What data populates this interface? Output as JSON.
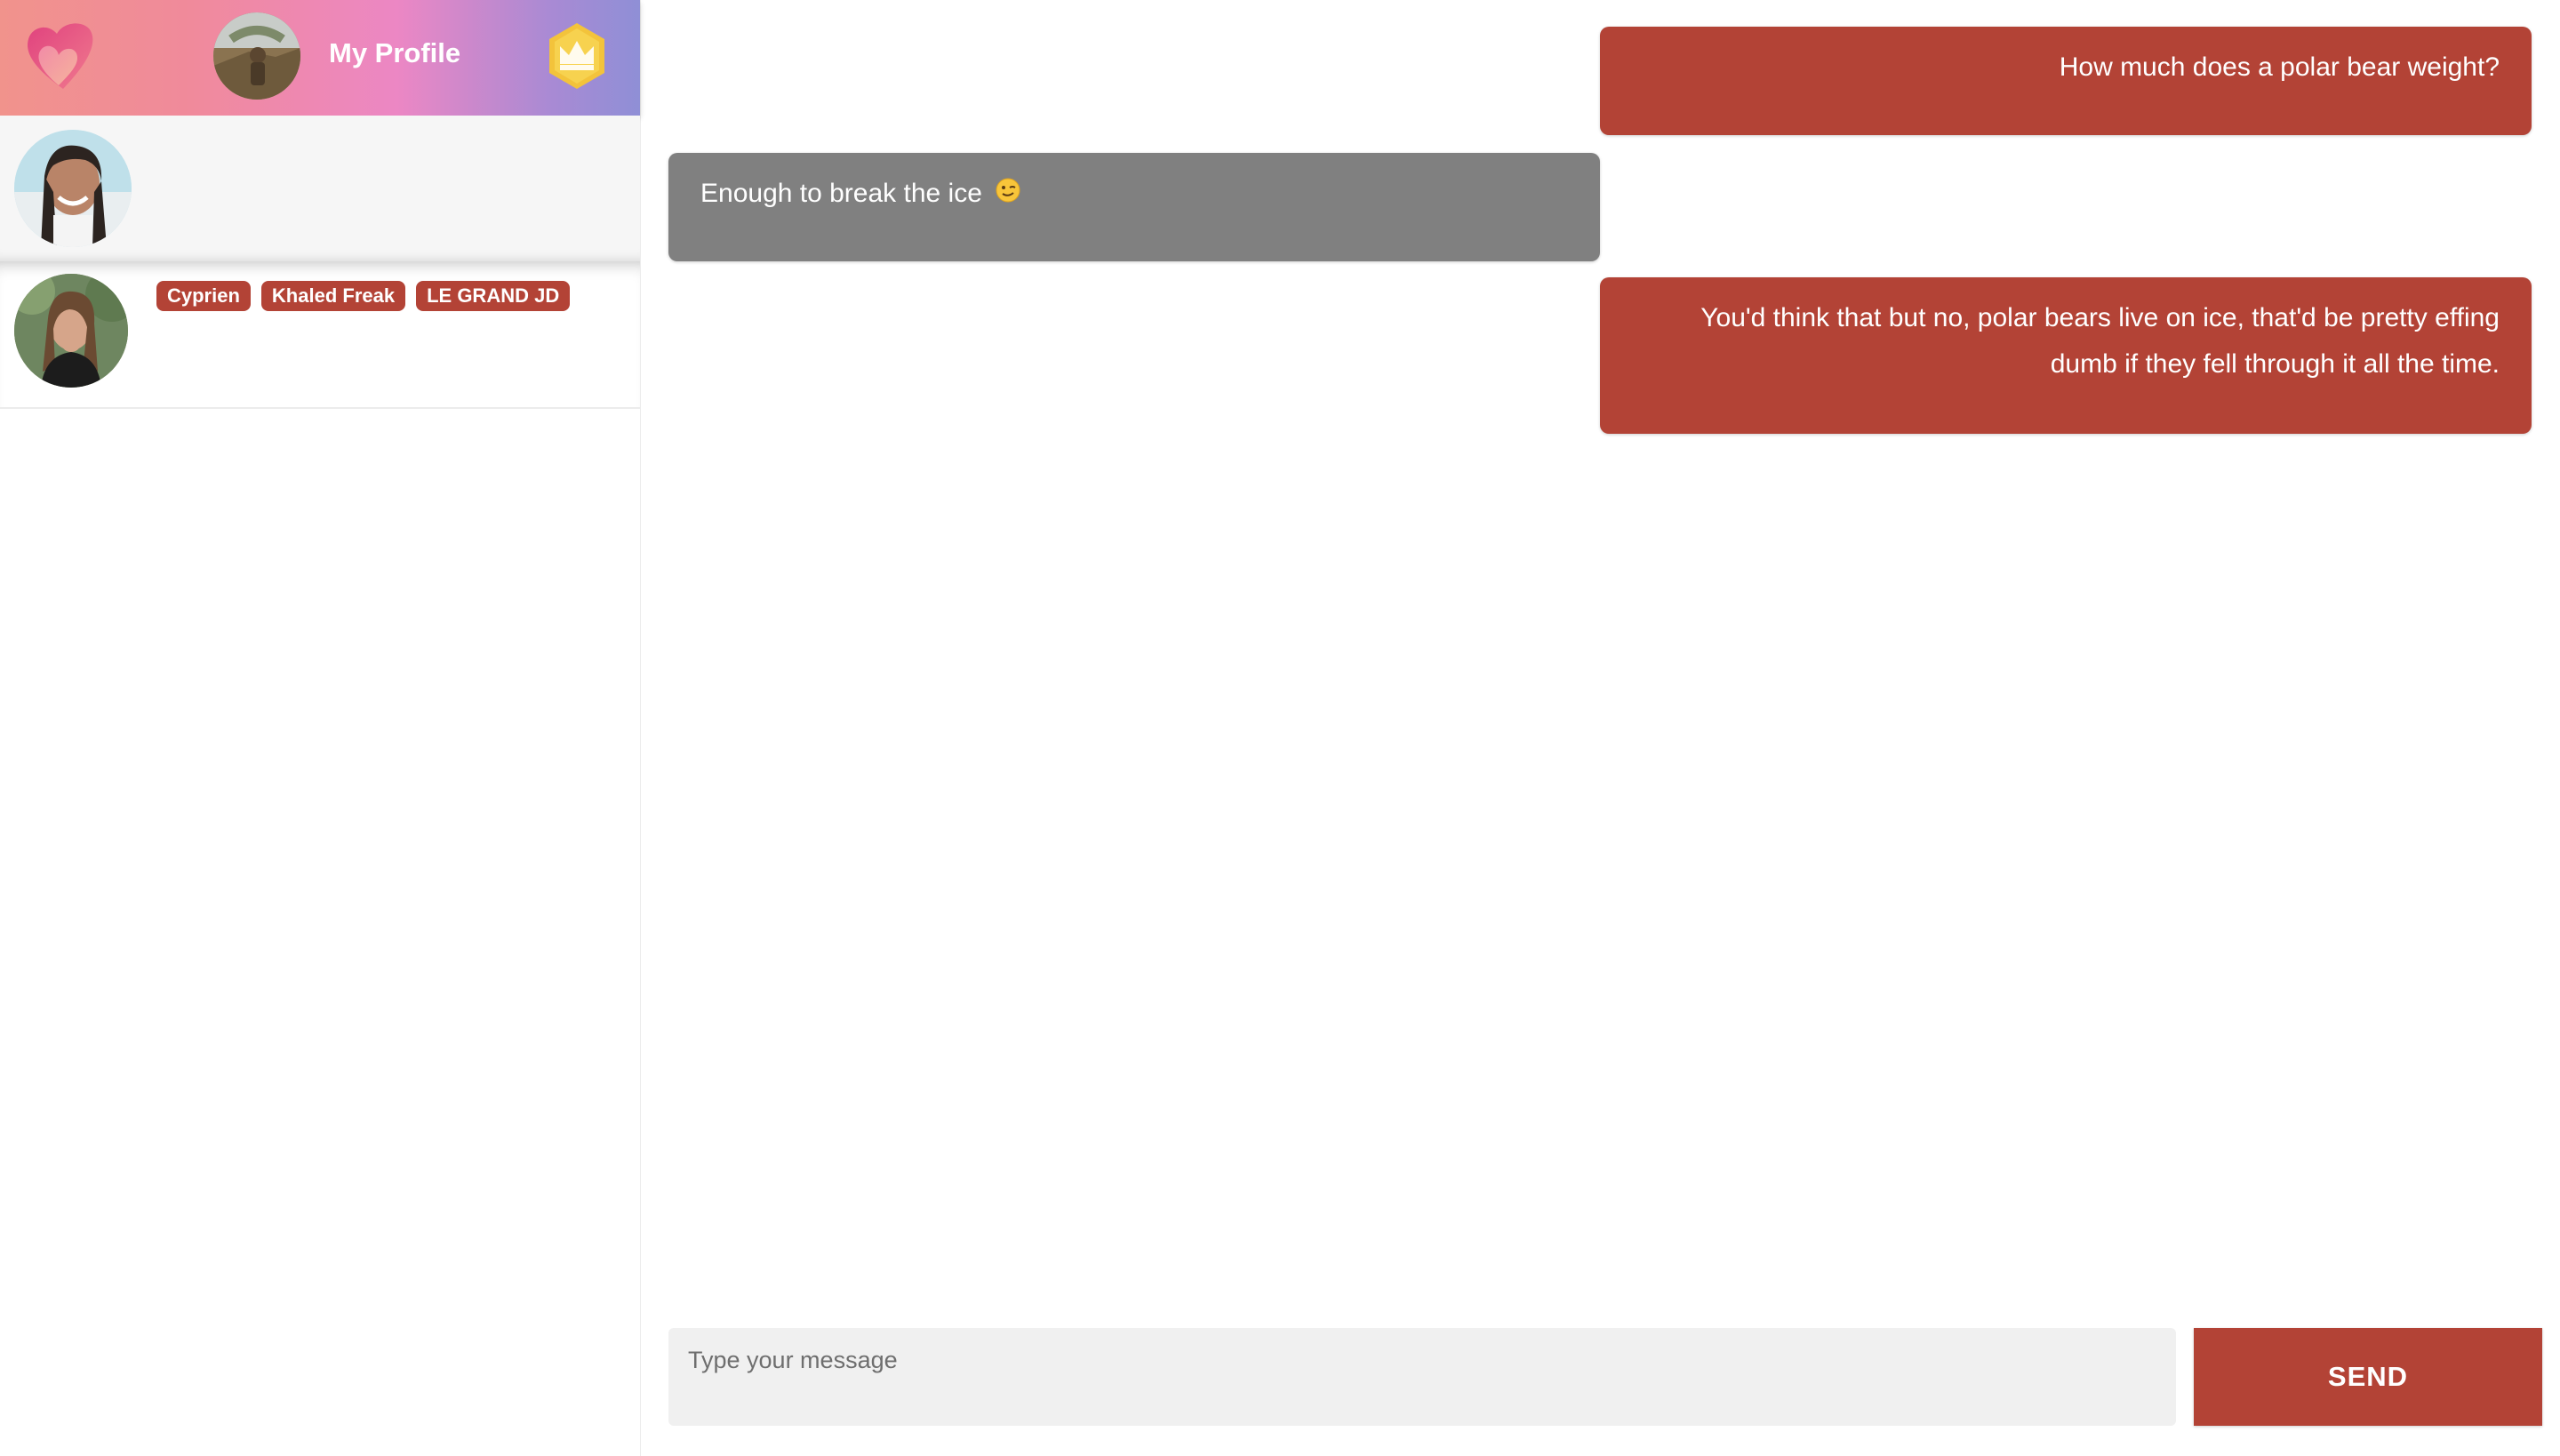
{
  "header": {
    "title": "My Profile",
    "logo_icon": "heart-logo-icon",
    "premium_icon": "crown-icon"
  },
  "sidebar": {
    "match": {
      "avatar_icon": "avatar"
    },
    "conversations": [
      {
        "avatar_icon": "avatar",
        "tags": [
          "Cyprien",
          "Khaled Freak",
          "LE GRAND JD"
        ]
      }
    ]
  },
  "messages": [
    {
      "direction": "sent",
      "text": "How much does a polar bear weight?"
    },
    {
      "direction": "received",
      "text": "Enough to break the ice",
      "emoji": "winking-face-emoji"
    },
    {
      "direction": "sent",
      "text": "You'd think that but no, polar bears live on ice, that'd be pretty effing dumb if they fell through it all the time."
    }
  ],
  "composer": {
    "placeholder": "Type your message",
    "value": ""
  },
  "send": {
    "label": "SEND"
  },
  "colors": {
    "accent": "#b34336",
    "received_bubble": "#808080",
    "header_gradient": [
      "#f1938c",
      "#ec87c4",
      "#8f8fd6"
    ]
  }
}
